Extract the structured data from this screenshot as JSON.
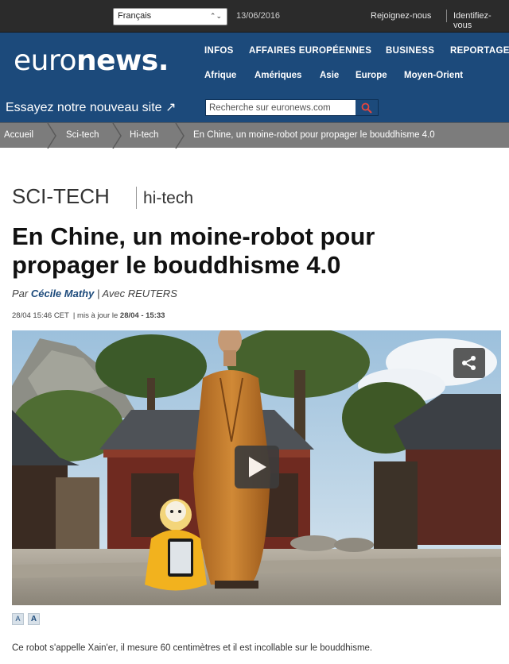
{
  "topbar": {
    "language": "Français",
    "date": "13/06/2016",
    "join_label": "Rejoignez-nous",
    "login_label": "Identifiez-vous"
  },
  "header": {
    "logo_light": "euro",
    "logo_bold": "news.",
    "nav_primary": [
      "INFOS",
      "AFFAIRES EUROPÉENNES",
      "BUSINESS",
      "REPORTAGES"
    ],
    "nav_secondary": [
      "Afrique",
      "Amériques",
      "Asie",
      "Europe",
      "Moyen-Orient"
    ],
    "try_new_site": "Essayez notre nouveau site ↗",
    "search_placeholder": "Recherche sur euronews.com"
  },
  "breadcrumb": [
    "Accueil",
    "Sci-tech",
    "Hi-tech",
    "En Chine, un moine-robot pour propager le bouddhisme 4.0"
  ],
  "article": {
    "section": "SCI-TECH",
    "subsection": "hi-tech",
    "headline_line1": "En Chine, un moine-robot pour",
    "headline_line2": "propager le bouddhisme 4.0",
    "by_prefix": "Par",
    "author": "Cécile Mathy",
    "by_suffix": "| Avec REUTERS",
    "published": "28/04 15:46 CET",
    "updated_label": "mis à jour le",
    "updated": "28/04 - 15:33",
    "font_small": "A",
    "font_large": "A",
    "caption": "Ce robot s'appelle Xain'er, il mesure 60 centimètres et il est incollable sur le bouddhisme."
  },
  "colors": {
    "brand_blue": "#1c4a7b",
    "topbar": "#2b2b2b",
    "breadcrumb": "#7c7c7c",
    "robe": "#c87a2a",
    "robot": "#f2b21e"
  },
  "icons": [
    "search-icon",
    "share-icon",
    "play-icon",
    "external-link-icon",
    "chevron-down-icon"
  ]
}
